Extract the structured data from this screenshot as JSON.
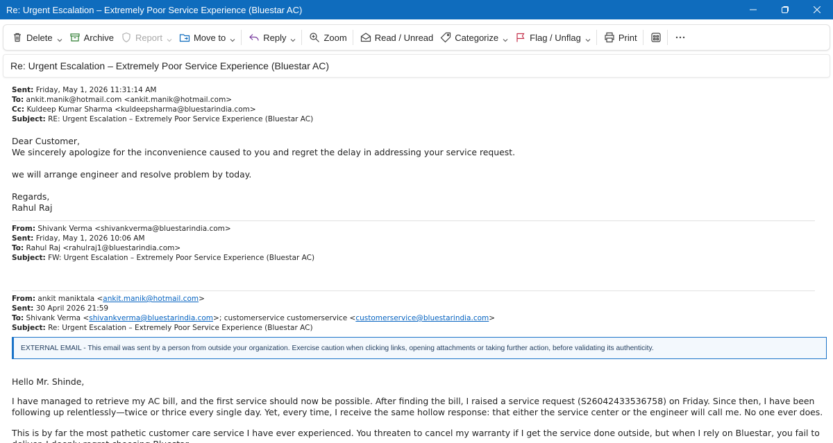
{
  "window": {
    "title": "Re: Urgent Escalation – Extremely Poor Service Experience (Bluestar AC)"
  },
  "toolbar": {
    "delete": "Delete",
    "archive": "Archive",
    "report": "Report",
    "move_to": "Move to",
    "reply": "Reply",
    "zoom": "Zoom",
    "read_unread": "Read / Unread",
    "categorize": "Categorize",
    "flag_unflag": "Flag / Unflag",
    "print": "Print"
  },
  "subject": "Re: Urgent Escalation – Extremely Poor Service Experience (Bluestar AC)",
  "message1": {
    "sent_label": "Sent:",
    "sent": "Friday, May 1, 2026 11:31:14 AM",
    "to_label": "To:",
    "to": "ankit.manik@hotmail.com <ankit.manik@hotmail.com>",
    "cc_label": "Cc:",
    "cc": "Kuldeep Kumar Sharma <kuldeepsharma@bluestarindia.com>",
    "subject_label": "Subject:",
    "subject": "RE: Urgent Escalation – Extremely Poor Service Experience (Bluestar AC)",
    "greeting": "Dear Customer,",
    "line1": "We sincerely apologize for the inconvenience caused to you and regret the delay in addressing your service request.",
    "line2": "we will arrange engineer and resolve problem by today.",
    "signoff": "Regards,",
    "signature": "Rahul Raj"
  },
  "message2": {
    "from_label": "From:",
    "from": "Shivank Verma <shivankverma@bluestarindia.com>",
    "sent_label": "Sent:",
    "sent": "Friday, May 1, 2026 10:06 AM",
    "to_label": "To:",
    "to": "Rahul Raj <rahulraj1@bluestarindia.com>",
    "subject_label": "Subject:",
    "subject": "FW: Urgent Escalation – Extremely Poor Service Experience (Bluestar AC)"
  },
  "message3": {
    "from_label": "From:",
    "from_name": "ankit maniktala <",
    "from_email": "ankit.manik@hotmail.com",
    "from_close": ">",
    "sent_label": "Sent:",
    "sent": "30 April 2026 21:59",
    "to_label": "To:",
    "to_name1": "Shivank Verma <",
    "to_email1": "shivankverma@bluestarindia.com",
    "to_mid": ">; customerservice customerservice <",
    "to_email2": "customerservice@bluestarindia.com",
    "to_close": ">",
    "subject_label": "Subject:",
    "subject": "Re: Urgent Escalation – Extremely Poor Service Experience (Bluestar AC)",
    "external_banner": "EXTERNAL EMAIL - This email was sent by a person from outside your organization. Exercise caution when clicking links, opening attachments or taking further action, before validating its authenticity.",
    "greeting": "Hello Mr. Shinde,",
    "para1": "I have managed to retrieve my AC bill, and the first service should now be possible. After finding the bill, I raised a service request (S26042433536758) on Friday. Since then, I have been following up relentlessly—twice or thrice every single day. Yet, every time, I receive the same hollow response: that either the service center or the engineer will call me. No one ever does.",
    "para2": "This is by far the most pathetic customer care service I have ever experienced. You threaten to cancel my warranty if I get the service done outside, but when I rely on Bluestar, you fail to deliver. I deeply regret choosing Bluestar."
  },
  "colors": {
    "titlebar": "#0f6cbd",
    "link": "#0563c1",
    "banner_border": "#1a73c8"
  }
}
